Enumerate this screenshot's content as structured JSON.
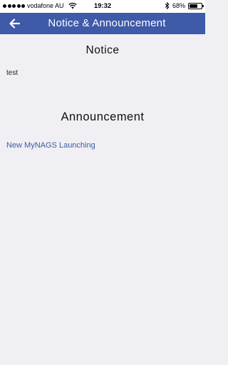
{
  "status_bar": {
    "carrier": "vodafone AU",
    "time": "19:32",
    "battery": "68%",
    "battery_level": 0.68,
    "icons": [
      "signal-dots-icon",
      "wifi-icon",
      "bluetooth-icon",
      "battery-icon"
    ]
  },
  "app_bar": {
    "title": "Notice & Announcement",
    "back_icon": "arrow-left-icon",
    "color": "#3e5aa8"
  },
  "notice": {
    "heading": "Notice",
    "items": [
      "test"
    ]
  },
  "announcement": {
    "heading": "Announcement",
    "items": [
      "New MyNAGS Launching"
    ],
    "link_color": "#3e5aa8"
  }
}
